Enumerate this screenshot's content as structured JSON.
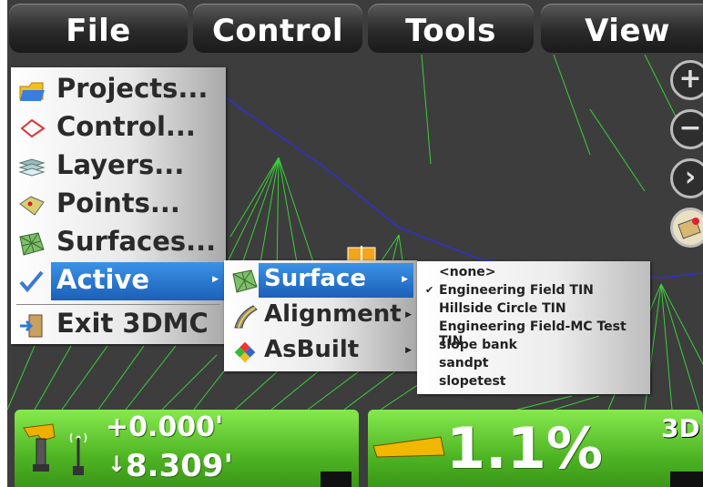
{
  "top_menu": {
    "file": "File",
    "control": "Control",
    "tools": "Tools",
    "view": "View"
  },
  "zoom": {
    "plus": "+",
    "minus": "−",
    "next": "›"
  },
  "file_menu": {
    "items": [
      "Projects...",
      "Control...",
      "Layers...",
      "Points...",
      "Surfaces...",
      "Active",
      "Exit 3DMC"
    ]
  },
  "active_menu": {
    "items": [
      "Surface",
      "Alignment",
      "AsBuilt"
    ]
  },
  "surface_menu": {
    "items": [
      "<none>",
      "Engineering Field TIN",
      "Hillside Circle TIN",
      "Engineering Field-MC Test TIN",
      "slope bank",
      "sandpt",
      "slopetest"
    ],
    "checked_index": 1,
    "check_mark": "✔"
  },
  "status_left": {
    "cut_fill": "+0.000'",
    "elevation": "8.309'",
    "down_arrow": "↓"
  },
  "status_right": {
    "slope": "1.1%",
    "mode": "3D"
  },
  "colors": {
    "selected": "#2b7fd6",
    "panel_green": "#5ac02c",
    "line_blue": "#2d2df0",
    "line_green": "#39d03a",
    "slope_bar": "#f0b800"
  }
}
